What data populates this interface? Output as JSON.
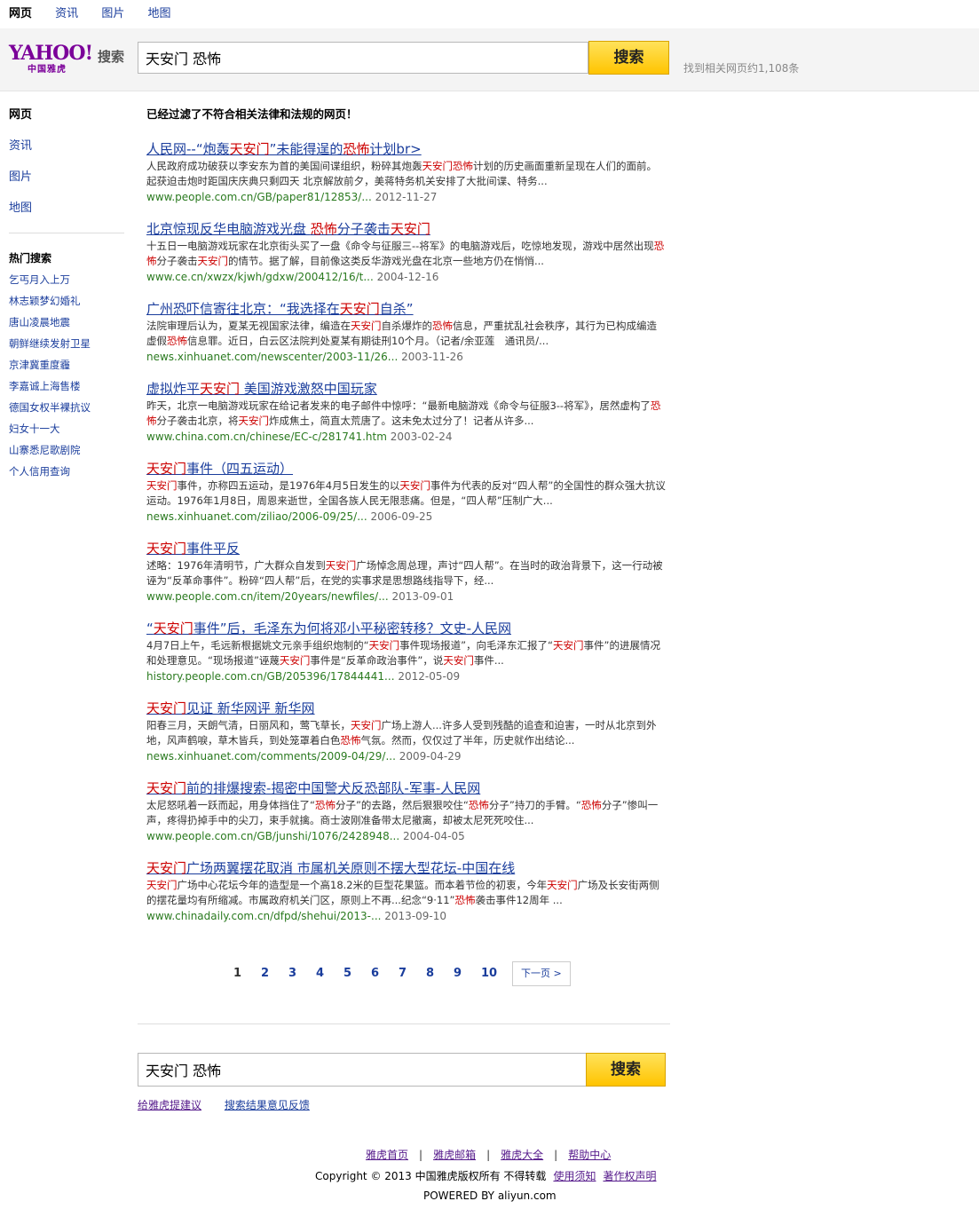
{
  "topnav": [
    "网页",
    "资讯",
    "图片",
    "地图"
  ],
  "logo": {
    "brand": "YAHOO!",
    "sub": "中国雅虎",
    "search": "搜索"
  },
  "search": {
    "query": "天安门 恐怖",
    "button": "搜索"
  },
  "result_count": "找到相关网页约1,108条",
  "sidebar": {
    "nav": [
      "网页",
      "资讯",
      "图片",
      "地图"
    ],
    "hot_title": "热门搜索",
    "hot": [
      "乞丐月入上万",
      "林志颖梦幻婚礼",
      "唐山凌晨地震",
      "朝鲜继续发射卫星",
      "京津冀重度霾",
      "李嘉诚上海售楼",
      "德国女权半裸抗议",
      "妇女十一大",
      "山寨悉尼歌剧院",
      "个人信用查询"
    ]
  },
  "filter_note": "已经过滤了不符合相关法律和法规的网页！",
  "results": [
    {
      "title": [
        [
          "人民网--“炮轰",
          0
        ],
        [
          "天安门",
          1
        ],
        [
          "”未能得逞的",
          0
        ],
        [
          "恐怖",
          1
        ],
        [
          "计划br>",
          0
        ]
      ],
      "snippet": [
        [
          "人民政府成功破获以李安东为首的美国间谍组织，粉碎其炮轰",
          0
        ],
        [
          "天安门恐怖",
          1
        ],
        [
          "计划的历史画面重新呈现在人们的面前。起获迫击炮时距国庆庆典只剩四天 北京解放前夕，美蒋特务机关安排了大批间谍、特务...",
          0
        ]
      ],
      "url": "www.people.com.cn/GB/paper81/12853/...",
      "date": "2012-11-27"
    },
    {
      "title": [
        [
          "北京惊现反华电脑游戏光盘 ",
          0
        ],
        [
          "恐怖",
          1
        ],
        [
          "分子袭击",
          0
        ],
        [
          "天安门",
          1
        ]
      ],
      "snippet": [
        [
          "十五日一电脑游戏玩家在北京街头买了一盘《命令与征服三--将军》的电脑游戏后，吃惊地发现，游戏中居然出现",
          0
        ],
        [
          "恐怖",
          1
        ],
        [
          "分子袭击",
          0
        ],
        [
          "天安门",
          1
        ],
        [
          "的情节。据了解，目前像这类反华游戏光盘在北京一些地方仍在悄悄...",
          0
        ]
      ],
      "url": "www.ce.cn/xwzx/kjwh/gdxw/200412/16/t...",
      "date": "2004-12-16"
    },
    {
      "title": [
        [
          "广州恐吓信寄往北京：“我选择在",
          0
        ],
        [
          "天安门",
          1
        ],
        [
          "自杀”",
          0
        ]
      ],
      "snippet": [
        [
          "法院审理后认为，夏某无视国家法律，编造在",
          0
        ],
        [
          "天安门",
          1
        ],
        [
          "自杀爆炸的",
          0
        ],
        [
          "恐怖",
          1
        ],
        [
          "信息，严重扰乱社会秩序，其行为已构成编造虚假",
          0
        ],
        [
          "恐怖",
          1
        ],
        [
          "信息罪。近日，白云区法院判处夏某有期徒刑10个月。（记者/余亚莲　通讯员/...",
          0
        ]
      ],
      "url": "news.xinhuanet.com/newscenter/2003-11/26...",
      "date": "2003-11-26"
    },
    {
      "title": [
        [
          "虚拟炸平",
          0
        ],
        [
          "天安门",
          1
        ],
        [
          " 美国游戏激怒中国玩家",
          0
        ]
      ],
      "snippet": [
        [
          "昨天，北京一电脑游戏玩家在给记者发来的电子邮件中惊呼：“最新电脑游戏《命令与征服3--将军》，居然虚构了",
          0
        ],
        [
          "恐怖",
          1
        ],
        [
          "分子袭击北京，将",
          0
        ],
        [
          "天安门",
          1
        ],
        [
          "炸成焦土，简直太荒唐了。这未免太过分了！记者从许多...",
          0
        ]
      ],
      "url": "www.china.com.cn/chinese/EC-c/281741.htm",
      "date": "2003-02-24"
    },
    {
      "title": [
        [
          "天安门",
          1
        ],
        [
          "事件（四五运动）",
          0
        ]
      ],
      "snippet": [
        [
          "天安门",
          1
        ],
        [
          "事件，亦称四五运动，是1976年4月5日发生的以",
          0
        ],
        [
          "天安门",
          1
        ],
        [
          "事件为代表的反对“四人帮”的全国性的群众强大抗议运动。1976年1月8日，周恩来逝世，全国各族人民无限悲痛。但是，“四人帮”压制广大...",
          0
        ]
      ],
      "url": "news.xinhuanet.com/ziliao/2006-09/25/...",
      "date": "2006-09-25"
    },
    {
      "title": [
        [
          "天安门",
          1
        ],
        [
          "事件平反",
          0
        ]
      ],
      "snippet": [
        [
          "述略：1976年清明节，广大群众自发到",
          0
        ],
        [
          "天安门",
          1
        ],
        [
          "广场悼念周总理，声讨“四人帮”。在当时的政治背景下，这一行动被诬为“反革命事件”。粉碎“四人帮”后，在党的实事求是思想路线指导下，经...",
          0
        ]
      ],
      "url": "www.people.com.cn/item/20years/newfiles/...",
      "date": "2013-09-01"
    },
    {
      "title": [
        [
          "“",
          0
        ],
        [
          "天安门",
          1
        ],
        [
          "事件”后，毛泽东为何将邓小平秘密转移？文史-人民网",
          0
        ]
      ],
      "snippet": [
        [
          "4月7日上午，毛远新根据姚文元亲手组织炮制的“",
          0
        ],
        [
          "天安门",
          1
        ],
        [
          "事件现场报道”，向毛泽东汇报了“",
          0
        ],
        [
          "天安门",
          1
        ],
        [
          "事件”的进展情况和处理意见。“现场报道”诬蔑",
          0
        ],
        [
          "天安门",
          1
        ],
        [
          "事件是“反革命政治事件”，说",
          0
        ],
        [
          "天安门",
          1
        ],
        [
          "事件...",
          0
        ]
      ],
      "url": "history.people.com.cn/GB/205396/17844441...",
      "date": "2012-05-09"
    },
    {
      "title": [
        [
          "天安门",
          1
        ],
        [
          "见证 新华网评 新华网",
          0
        ]
      ],
      "snippet": [
        [
          "阳春三月，天朗气清，日丽风和，莺飞草长，",
          0
        ],
        [
          "天安门",
          1
        ],
        [
          "广场上游人...许多人受到残酷的追查和迫害，一时从北京到外地，风声鹤唳，草木皆兵，到处笼罩着白色",
          0
        ],
        [
          "恐怖",
          1
        ],
        [
          "气氛。然而，仅仅过了半年，历史就作出结论...",
          0
        ]
      ],
      "url": "news.xinhuanet.com/comments/2009-04/29/...",
      "date": "2009-04-29"
    },
    {
      "title": [
        [
          "天安门",
          1
        ],
        [
          "前的排爆搜索-揭密中国警犬反恐部队-军事-人民网",
          0
        ]
      ],
      "snippet": [
        [
          "太尼怒吼着一跃而起，用身体挡住了“",
          0
        ],
        [
          "恐怖",
          1
        ],
        [
          "分子”的去路，然后狠狠咬住“",
          0
        ],
        [
          "恐怖",
          1
        ],
        [
          "分子”持刀的手臂。“",
          0
        ],
        [
          "恐怖",
          1
        ],
        [
          "分子”惨叫一声，疼得扔掉手中的尖刀，束手就擒。商士波刚准备带太尼撤离，却被太尼死死咬住...",
          0
        ]
      ],
      "url": "www.people.com.cn/GB/junshi/1076/2428948...",
      "date": "2004-04-05"
    },
    {
      "title": [
        [
          "天安门",
          1
        ],
        [
          "广场两翼摆花取消 市属机关原则不摆大型花坛-中国在线",
          0
        ]
      ],
      "snippet": [
        [
          "天安门",
          1
        ],
        [
          "广场中心花坛今年的造型是一个高18.2米的巨型花果篮。而本着节俭的初衷，今年",
          0
        ],
        [
          "天安门",
          1
        ],
        [
          "广场及长安街两侧的摆花量均有所缩减。市属政府机关门区，原则上不再...纪念“9·11”",
          0
        ],
        [
          "恐怖",
          1
        ],
        [
          "袭击事件12周年 ...",
          0
        ]
      ],
      "url": "www.chinadaily.com.cn/dfpd/shehui/2013-...",
      "date": "2013-09-10"
    }
  ],
  "pager": {
    "pages": [
      "1",
      "2",
      "3",
      "4",
      "5",
      "6",
      "7",
      "8",
      "9",
      "10"
    ],
    "current": "1",
    "next": "下一页 >"
  },
  "bottom_search": {
    "query": "天安门 恐怖",
    "button": "搜索"
  },
  "feedback": [
    "给雅虎提建议",
    "搜索结果意见反馈"
  ],
  "footer": {
    "links": [
      "雅虎首页",
      "雅虎邮箱",
      "雅虎大全",
      "帮助中心"
    ],
    "separator": "|",
    "copyright": "Copyright © 2013 中国雅虎版权所有 不得转载",
    "legal": [
      "使用须知",
      "著作权声明"
    ],
    "powered": "POWERED BY aliyun.com"
  },
  "colors": {
    "link": "#1a3d9c",
    "highlight": "#c00000",
    "url": "#2a7a1f",
    "brand": "#7b0099",
    "button": "#ffc400"
  }
}
